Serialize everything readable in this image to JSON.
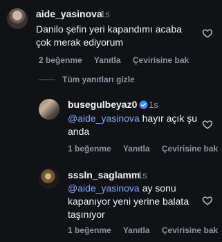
{
  "comment_main": {
    "username": "aide_yasinova",
    "time": "1s",
    "text_line1": "Danilo şefin yeri kapandımı acaba",
    "text_line2": "çok merak ediyorum",
    "likes": "2 beğenme",
    "reply": "Yanıtla",
    "translate": "Çevirisine bak"
  },
  "hide_replies": "Tüm yanıtları gizle",
  "replies": [
    {
      "username": "busegulbeyaz0",
      "time": "1s",
      "mention": "@aide_yasinova",
      "text_rest": " hayır açık şu",
      "text_line2": "anda",
      "likes": "1 beğenme",
      "reply": "Yanıtla",
      "translate": "Çevirisine bak"
    },
    {
      "username": "sssln_saglamm",
      "time": "1s",
      "mention": "@aide_yasinova",
      "text_rest": " ay sonu",
      "text_line2": "kapanıyor yeni yerine balata",
      "text_line3": "taşınıyor",
      "likes": "1 beğenme",
      "reply": "Yanıtla",
      "translate": "Çevirisine bak"
    }
  ],
  "icons": {
    "heart": "heart-outline-icon",
    "verified": "verified-badge-icon"
  },
  "colors": {
    "background": "#101216",
    "mention": "#7aa8ff",
    "verified": "#3f8cff",
    "muted": "#8e95a0"
  }
}
